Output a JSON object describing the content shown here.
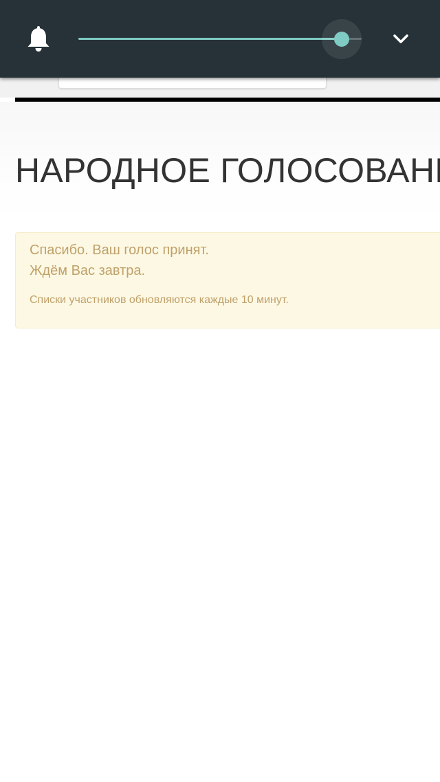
{
  "quick_panel": {
    "notification_icon": "bell-icon",
    "brightness_slider": {
      "value": 0.93,
      "fill_color": "#80cbc4"
    },
    "expand_icon": "chevron-down-icon",
    "background_color": "#263238"
  },
  "page": {
    "title": "НАРОДНОЕ ГОЛОСОВАНИ",
    "alert": {
      "line1": "Спасибо. Ваш голос принят.",
      "line2": "Ждём Вас завтра.",
      "note": "Списки участников обновляются каждые 10 минут.",
      "background_color": "#fcf8e3",
      "text_color": "#c0a16b"
    }
  }
}
